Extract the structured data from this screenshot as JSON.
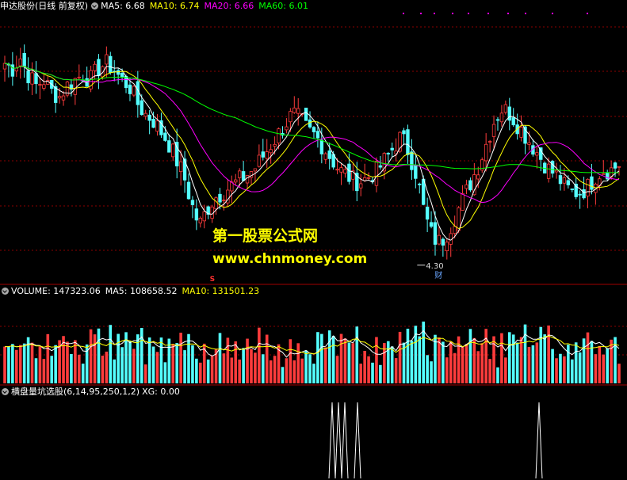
{
  "header": {
    "stock": "申达股份(日线 前复权)",
    "ma5": "MA5: 6.68",
    "ma10": "MA10: 6.74",
    "ma20": "MA20: 6.66",
    "ma60": "MA60: 6.01"
  },
  "volume_header": {
    "volume": "VOLUME: 147323.06",
    "ma5": "MA5: 108658.52",
    "ma10": "MA10: 131501.23"
  },
  "indicator_header": {
    "name": "横盘量坑选股(6,14,95,250,1,2)",
    "xg": "XG: 0.00"
  },
  "watermark": {
    "line1": "第一股票公式网",
    "line2": "www.chnmoney.com"
  },
  "annotations": {
    "low_price": "4.30",
    "finance_tag": "财",
    "s_marker": "S"
  },
  "colors": {
    "up": "#ff3c3c",
    "down": "#54ffff",
    "ma5": "#ffffff",
    "ma10": "#ffff00",
    "ma20": "#ff00ff",
    "ma60": "#00ff00",
    "grid": "#8b0000",
    "watermark": "#ffff00"
  },
  "chart_data": {
    "type": "candlestick",
    "price_axis": {
      "ylim": [
        4.0,
        8.8
      ]
    },
    "series_labels": [
      "MA5",
      "MA10",
      "MA20",
      "MA60"
    ],
    "key_points": [
      {
        "label": "low",
        "value": 4.3
      }
    ],
    "close_trend": [
      7.9,
      7.8,
      8.0,
      7.7,
      7.5,
      7.6,
      7.4,
      7.3,
      7.5,
      7.6,
      7.7,
      7.6,
      7.8,
      7.9,
      7.8,
      7.6,
      7.5,
      7.2,
      7.0,
      6.9,
      6.7,
      6.5,
      6.2,
      5.9,
      5.4,
      5.0,
      5.3,
      5.5,
      5.6,
      5.7,
      5.8,
      5.9,
      6.0,
      6.2,
      6.4,
      6.6,
      6.8,
      7.0,
      6.9,
      6.7,
      6.6,
      6.4,
      6.2,
      6.0,
      5.9,
      5.8,
      5.8,
      5.9,
      6.0,
      6.2,
      6.4,
      6.6,
      6.3,
      5.9,
      5.2,
      4.8,
      4.7,
      4.9,
      5.2,
      5.5,
      5.8,
      6.1,
      6.5,
      6.9,
      7.1,
      7.0,
      6.8,
      6.6,
      6.4,
      6.2,
      6.0,
      5.9,
      5.7,
      5.6,
      5.6,
      5.7,
      5.9,
      6.0,
      6.0,
      6.1
    ],
    "indicator_signals": [
      0.53,
      0.54,
      0.55,
      0.57,
      0.86
    ]
  }
}
